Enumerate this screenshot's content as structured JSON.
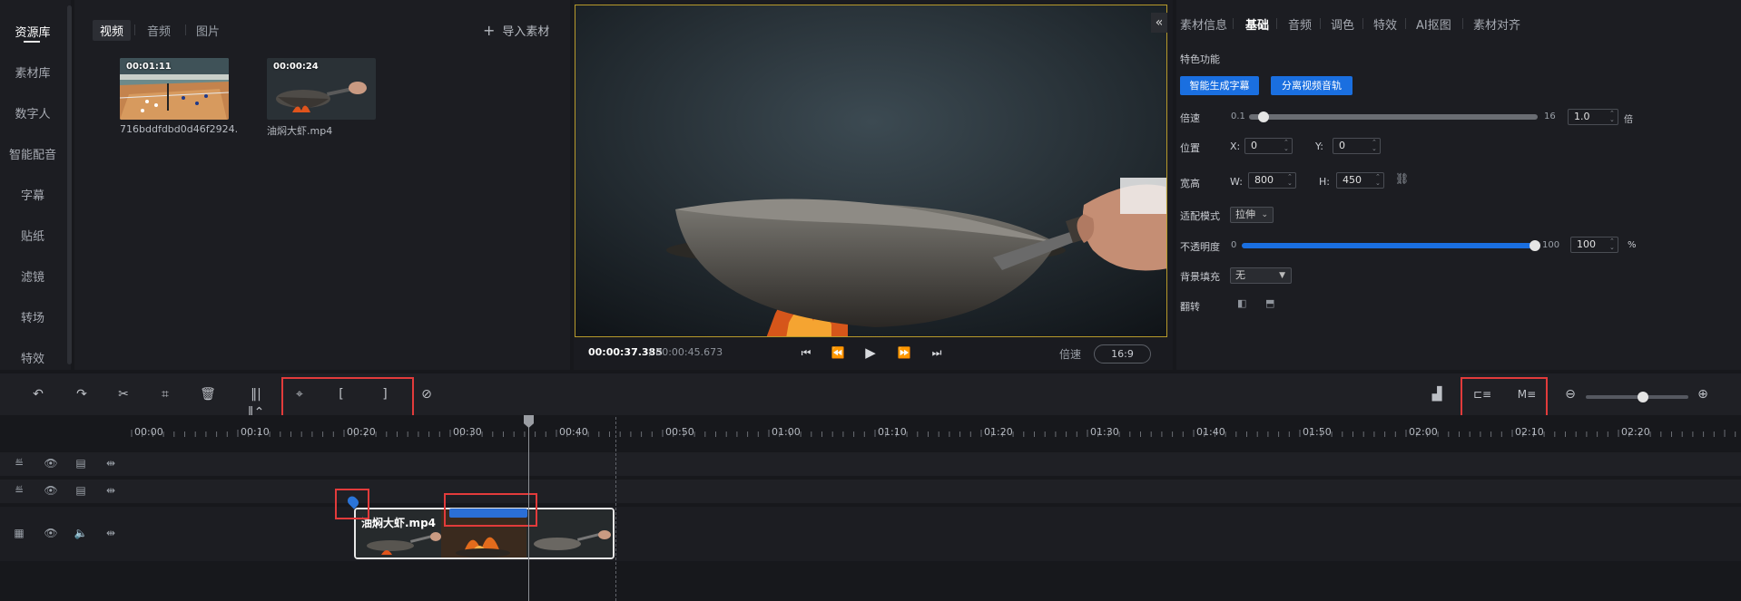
{
  "nav": {
    "items": [
      "资源库",
      "素材库",
      "数字人",
      "智能配音",
      "字幕",
      "贴纸",
      "滤镜",
      "转场",
      "特效"
    ],
    "active_index": 0
  },
  "media": {
    "tabs": [
      "视频",
      "音频",
      "图片"
    ],
    "active_tab": 0,
    "import_label": "导入素材",
    "items": [
      {
        "duration": "00:01:11",
        "name": "716bddfdbd0d46f2924..."
      },
      {
        "duration": "00:00:24",
        "name": "油焖大虾.mp4"
      }
    ]
  },
  "preview": {
    "collapse_icon": "«",
    "current_time": "00:00:37.385",
    "total_time": "/ 00:00:45.673",
    "speed_label": "倍速",
    "ratio": "16:9"
  },
  "props": {
    "tabs": [
      "素材信息",
      "基础",
      "音频",
      "调色",
      "特效",
      "AI抠图",
      "素材对齐"
    ],
    "active_tab": 1,
    "feature_title": "特色功能",
    "btn_subtitle": "智能生成字幕",
    "btn_separate": "分离视频音轨",
    "speed": {
      "label": "倍速",
      "min": "0.1",
      "max": "16",
      "value": "1.0",
      "unit": "倍",
      "fraction": 0.02
    },
    "position": {
      "label": "位置",
      "x_label": "X:",
      "x": "0",
      "y_label": "Y:",
      "y": "0"
    },
    "size": {
      "label": "宽高",
      "w_label": "W:",
      "w": "800",
      "h_label": "H:",
      "h": "450"
    },
    "fit": {
      "label": "适配模式",
      "value": "拉伸"
    },
    "opacity": {
      "label": "不透明度",
      "min": "0",
      "max": "100",
      "value": "100",
      "unit": "%",
      "fraction": 1.0
    },
    "bg": {
      "label": "背景填充",
      "value": "无"
    },
    "flip": {
      "label": "翻转"
    }
  },
  "timeline": {
    "ticks": [
      "00:00",
      "00:10",
      "00:20",
      "00:30",
      "00:40",
      "00:50",
      "01:00",
      "01:10",
      "01:20",
      "01:30",
      "01:40",
      "01:50",
      "02:00",
      "02:10",
      "02:20"
    ],
    "clip_name": "油焖大虾.mp4"
  },
  "colors": {
    "accent": "#1a6fe0",
    "highlight": "#e23b3b"
  }
}
